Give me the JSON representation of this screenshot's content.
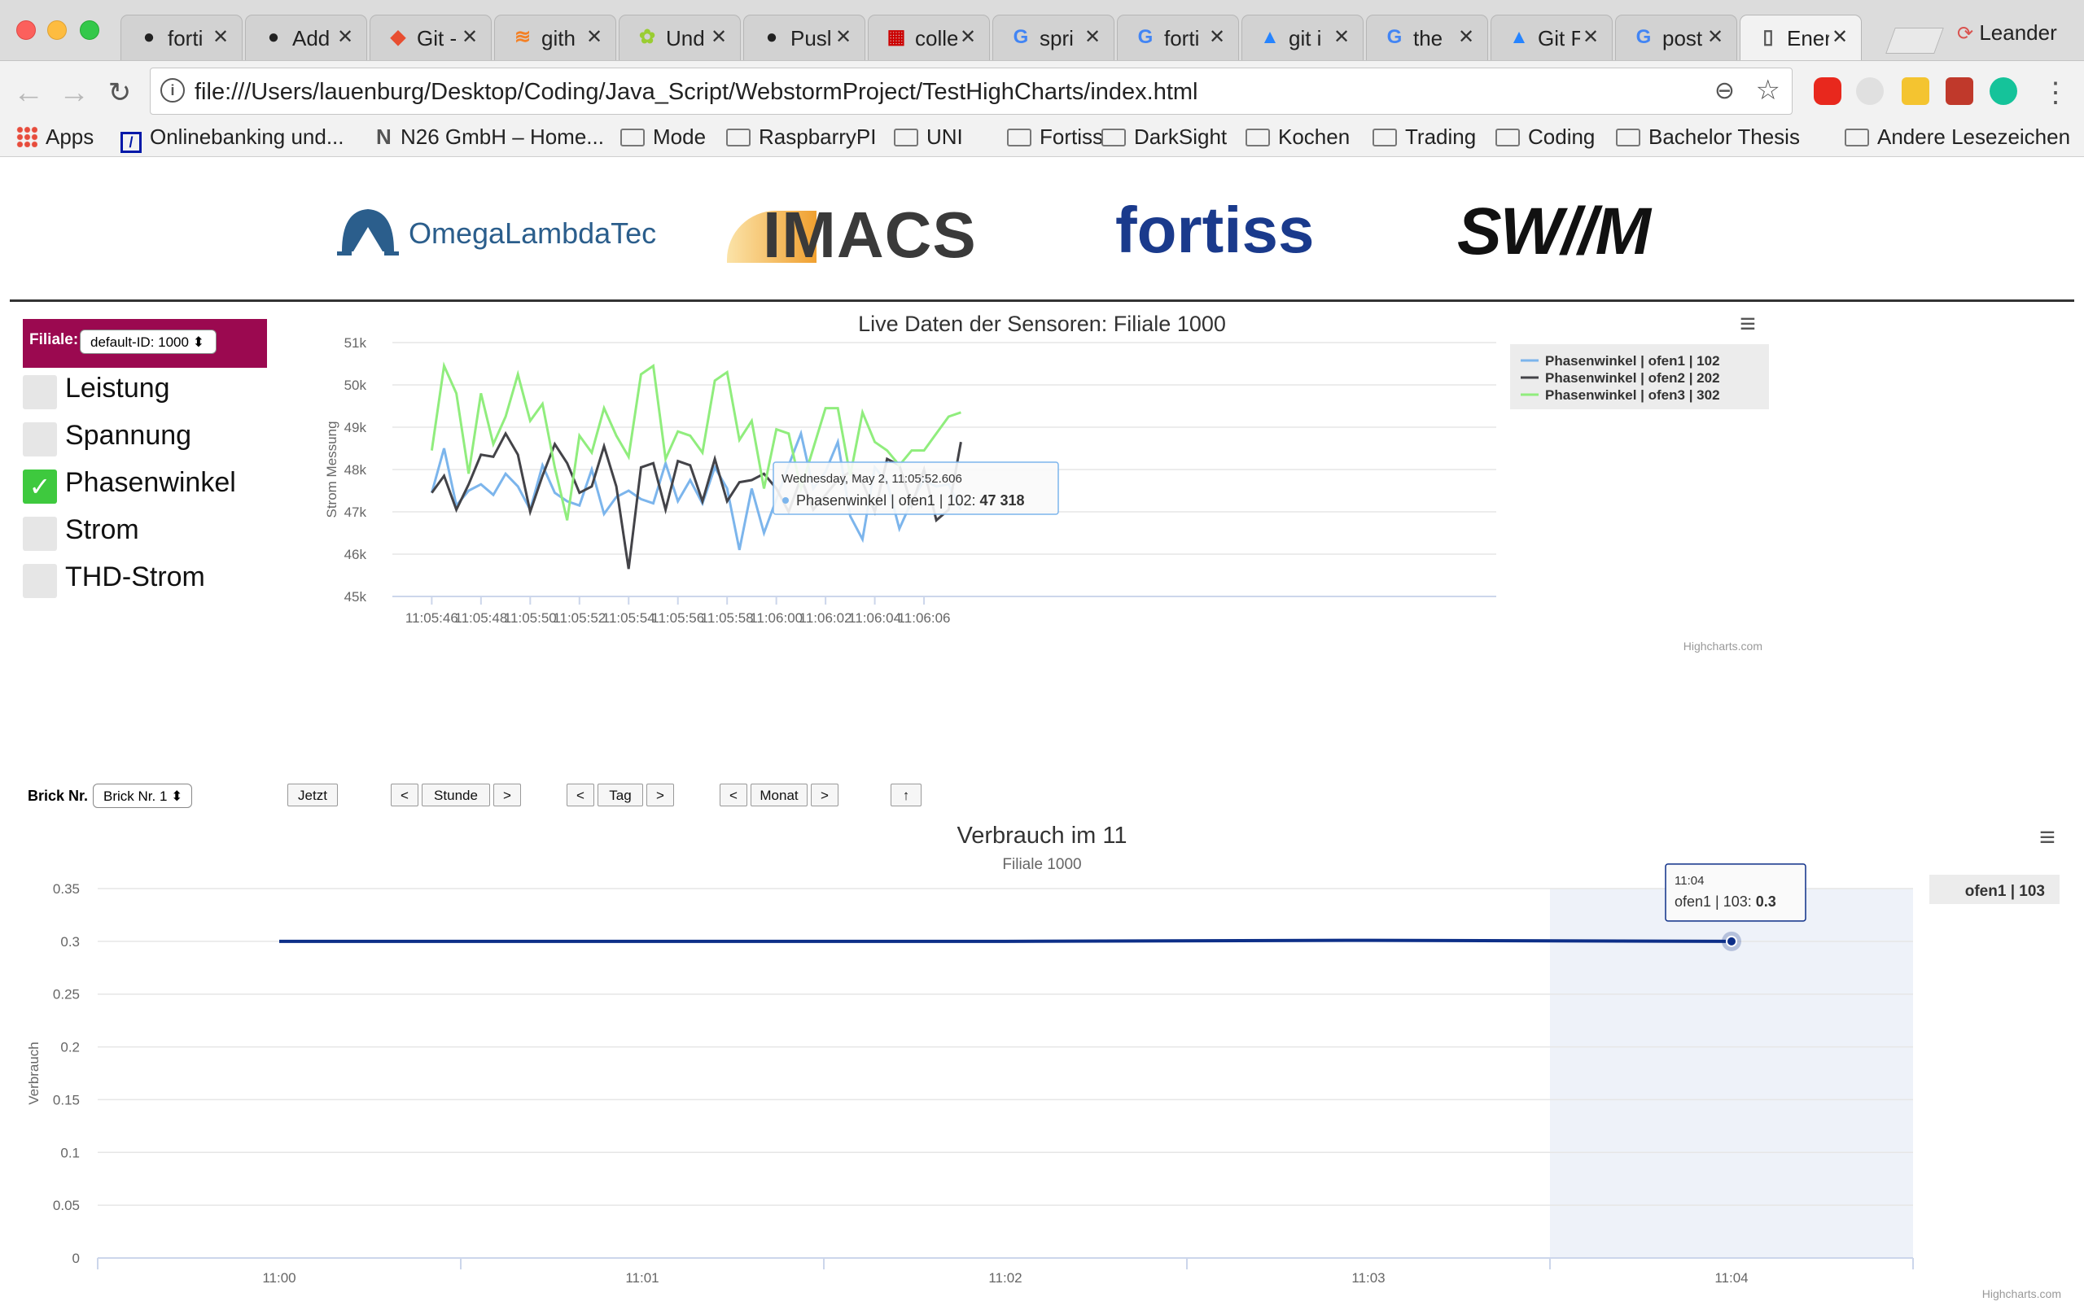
{
  "browser": {
    "tabs": [
      {
        "title": "forti",
        "icon": "github-icon"
      },
      {
        "title": "Add",
        "icon": "github-icon"
      },
      {
        "title": "Git -",
        "icon": "git-icon"
      },
      {
        "title": "gith",
        "icon": "stackoverflow-icon"
      },
      {
        "title": "Und",
        "icon": "web-icon"
      },
      {
        "title": "Pusl",
        "icon": "github-icon"
      },
      {
        "title": "colle",
        "icon": "flag-icon"
      },
      {
        "title": "spri",
        "icon": "google-icon"
      },
      {
        "title": "forti",
        "icon": "google-icon"
      },
      {
        "title": "git i",
        "icon": "atlassian-icon"
      },
      {
        "title": "the",
        "icon": "google-icon"
      },
      {
        "title": "Git F",
        "icon": "atlassian-icon"
      },
      {
        "title": "post",
        "icon": "google-icon"
      },
      {
        "title": "Ener",
        "icon": "document-icon"
      }
    ],
    "profile_name": "Leander",
    "url": "file:///Users/lauenburg/Desktop/Coding/Java_Script/WebstormProject/TestHighCharts/index.html",
    "bookmarks": [
      {
        "label": "Apps",
        "icon": "apps-grid-icon"
      },
      {
        "label": "Onlinebanking und...",
        "icon": "bank-icon"
      },
      {
        "label": "N26 GmbH – Home...",
        "icon": "n26-icon"
      },
      {
        "label": "Mode",
        "icon": "folder-icon"
      },
      {
        "label": "RaspbarryPI",
        "icon": "folder-icon"
      },
      {
        "label": "UNI",
        "icon": "folder-icon"
      },
      {
        "label": "Fortiss",
        "icon": "folder-icon"
      },
      {
        "label": "DarkSight",
        "icon": "folder-icon"
      },
      {
        "label": "Kochen",
        "icon": "folder-icon"
      },
      {
        "label": "Trading",
        "icon": "folder-icon"
      },
      {
        "label": "Coding",
        "icon": "folder-icon"
      },
      {
        "label": "Bachelor Thesis",
        "icon": "folder-icon"
      },
      {
        "label": "Andere Lesezeichen",
        "icon": "folder-icon"
      }
    ]
  },
  "logos": {
    "omega": "OmegaLambdaTec",
    "imacs": "IMACS",
    "fortiss": "fortiss",
    "swm": "SW//M"
  },
  "sidebar": {
    "filiale_label": "Filiale:",
    "filiale_value": "default-ID: 1000 ⬍",
    "options": [
      {
        "label": "Leistung",
        "checked": false
      },
      {
        "label": "Spannung",
        "checked": false
      },
      {
        "label": "Phasenwinkel",
        "checked": true
      },
      {
        "label": "Strom",
        "checked": false
      },
      {
        "label": "THD-Strom",
        "checked": false
      }
    ]
  },
  "controls": {
    "brick_label": "Brick Nr.",
    "brick_value": "Brick Nr. 1 ⬍",
    "now": "Jetzt",
    "prev": "<",
    "next": ">",
    "hour": "Stunde",
    "day": "Tag",
    "month": "Monat",
    "up": "↑"
  },
  "chart_data": [
    {
      "type": "line",
      "title": "Live Daten der Sensoren: Filiale 1000",
      "ylabel": "Strom Messung",
      "ylim": [
        45000,
        51000
      ],
      "yticks": [
        "45k",
        "46k",
        "47k",
        "48k",
        "49k",
        "50k",
        "51k"
      ],
      "xtick_labels": [
        "11:05:46",
        "11:05:48",
        "11:05:50",
        "11:05:52",
        "11:05:54",
        "11:05:56",
        "11:05:58",
        "11:06:00",
        "11:06:02",
        "11:06:04",
        "11:06:06"
      ],
      "x_start_index": 0,
      "points_per_tick": 4,
      "x_range_points": [
        -3.2,
        86.5
      ],
      "legend_position": "top-right",
      "credits": "Highcharts.com",
      "series": [
        {
          "name": "Phasenwinkel | ofen1 | 102",
          "color": "#7cb5ec",
          "values": [
            47450,
            48500,
            47150,
            47500,
            47650,
            47400,
            47900,
            47600,
            47050,
            48100,
            47450,
            47250,
            47150,
            48000,
            46950,
            47350,
            47500,
            47300,
            47200,
            48150,
            47250,
            47750,
            47200,
            48050,
            47550,
            46100,
            47550,
            46500,
            47300,
            48100,
            48850,
            47550,
            47950,
            48650,
            46900,
            46350,
            48050,
            47700,
            46600,
            47250,
            47750,
            47600,
            47650,
            47050
          ]
        },
        {
          "name": "Phasenwinkel | ofen2 | 202",
          "color": "#434348",
          "values": [
            47450,
            47850,
            47050,
            47650,
            48350,
            48300,
            48850,
            48350,
            47000,
            47850,
            48600,
            48150,
            47450,
            47600,
            48550,
            47600,
            45650,
            48050,
            48150,
            47050,
            48200,
            48100,
            47250,
            48250,
            47250,
            47700,
            47750,
            47900,
            47550,
            47000,
            47800,
            47050,
            47400,
            47750,
            47950,
            47700,
            47000,
            48250,
            48100,
            47150,
            48000,
            46800,
            47050,
            48650
          ]
        },
        {
          "name": "Phasenwinkel | ofen3 | 302",
          "color": "#90ed7d",
          "values": [
            48450,
            50450,
            49800,
            47900,
            49800,
            48600,
            49250,
            50250,
            49150,
            49550,
            48050,
            46800,
            48800,
            48400,
            49450,
            48800,
            48300,
            50250,
            50450,
            48250,
            48900,
            48800,
            48400,
            50100,
            50300,
            48700,
            49150,
            47550,
            48950,
            48850,
            47550,
            48500,
            49450,
            49450,
            47850,
            49350,
            48650,
            48450,
            48100,
            48450,
            48450,
            48850,
            49250,
            49350
          ]
        }
      ],
      "tooltip": {
        "header": "Wednesday, May 2, 11:05:52.606",
        "series": "Phasenwinkel | ofen1 | 102",
        "value": "47 318",
        "point_index": 16
      }
    },
    {
      "type": "line",
      "title": "Verbrauch im 11",
      "subtitle": "Filiale 1000",
      "ylabel": "Verbrauch",
      "ylim": [
        0,
        0.35
      ],
      "yticks": [
        "0",
        "0.05",
        "0.1",
        "0.15",
        "0.2",
        "0.25",
        "0.3",
        "0.35"
      ],
      "categories": [
        "11:00",
        "11:01",
        "11:02",
        "11:03",
        "11:04"
      ],
      "series": [
        {
          "name": "ofen1 | 103",
          "color": "#0d2f88",
          "values": [
            0.3,
            0.3,
            0.3,
            0.301,
            0.3
          ]
        }
      ],
      "legend_position": "right",
      "highlighted_category": 4,
      "tooltip": {
        "header": "11:04",
        "series": "ofen1 | 103",
        "value": "0.3"
      },
      "credits": "Highcharts.com"
    }
  ]
}
